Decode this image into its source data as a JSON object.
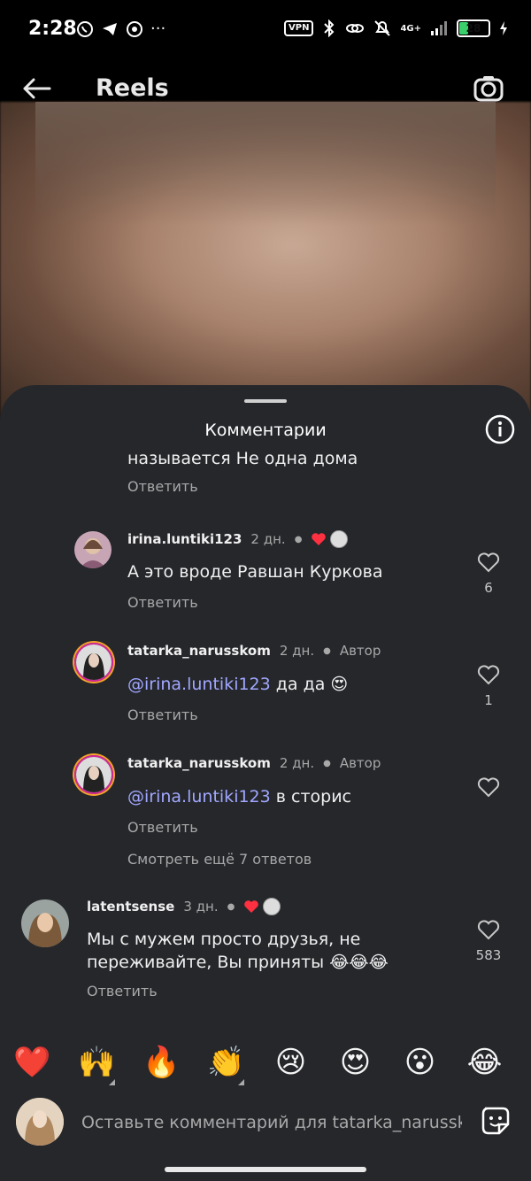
{
  "status": {
    "time": "2:28",
    "vpn": "VPN",
    "network": "4G+",
    "battery": "28",
    "battery_level": 0.28
  },
  "header": {
    "title": "Reels"
  },
  "sheet": {
    "title": "Комментарии"
  },
  "comments": {
    "partial_text": "называется Не одна дома",
    "reply_label": "Ответить",
    "items": [
      {
        "user": "irina.luntiki123",
        "time": "2 дн.",
        "text": "А это вроде Равшан Куркова",
        "likes": "6"
      },
      {
        "user": "tatarka_narusskom",
        "time": "2 дн.",
        "badge": "Автор",
        "mention": "@irina.luntiki123",
        "text": " да да 😍",
        "likes": "1"
      },
      {
        "user": "tatarka_narusskom",
        "time": "2 дн.",
        "badge": "Автор",
        "mention": "@irina.luntiki123",
        "text": " в сторис",
        "likes": ""
      },
      {
        "user": "latentsense",
        "time": "3 дн.",
        "text_line1": "Мы с мужем просто друзья, не",
        "text_line2": "переживайте, Вы приняты 😂😂😂",
        "likes": "583"
      }
    ],
    "more_replies": "Смотреть ещё 7 ответов"
  },
  "emoji_bar": [
    "❤️",
    "🙌",
    "🔥",
    "👏",
    "😢",
    "😍",
    "😮",
    "😂"
  ],
  "input": {
    "placeholder": "Оставьте комментарий для tatarka_narusskо"
  },
  "colors": {
    "sheet": "#25272b",
    "mention": "#a1a7ff",
    "like_red": "#ff3040"
  }
}
